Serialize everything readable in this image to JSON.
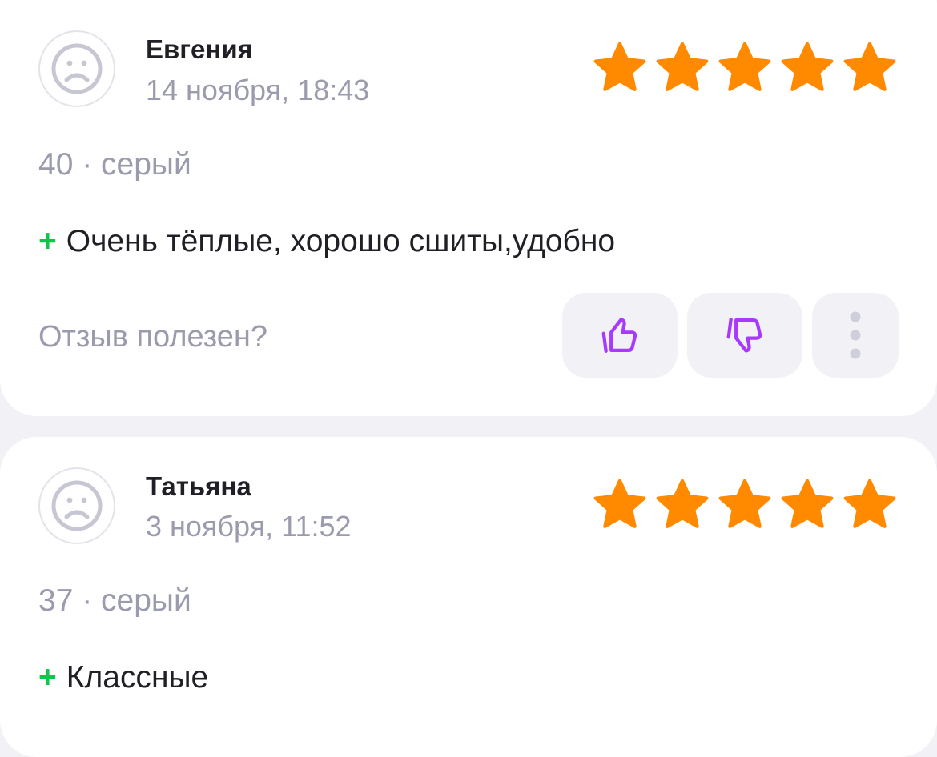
{
  "colors": {
    "background": "#f2f2f6",
    "card": "#ffffff",
    "star": "#ff8a00",
    "plus": "#10c44c",
    "thumb": "#a73afd",
    "secondary_text": "#9b9bae"
  },
  "helpful_prompt": "Отзыв полезен?",
  "reviews": [
    {
      "author": "Евгения",
      "date": "14 ноября, 18:43",
      "rating": 5,
      "params": "40 · серый",
      "pros_marker": "+",
      "pros": "Очень тёплые, хорошо сшиты,удобно",
      "actions": {
        "like_icon": "thumbs-up-icon",
        "dislike_icon": "thumbs-down-icon",
        "more_icon": "more-vertical-icon"
      }
    },
    {
      "author": "Татьяна",
      "date": "3 ноября, 11:52",
      "rating": 5,
      "params": "37 · серый",
      "pros_marker": "+",
      "pros": "Классные"
    }
  ]
}
